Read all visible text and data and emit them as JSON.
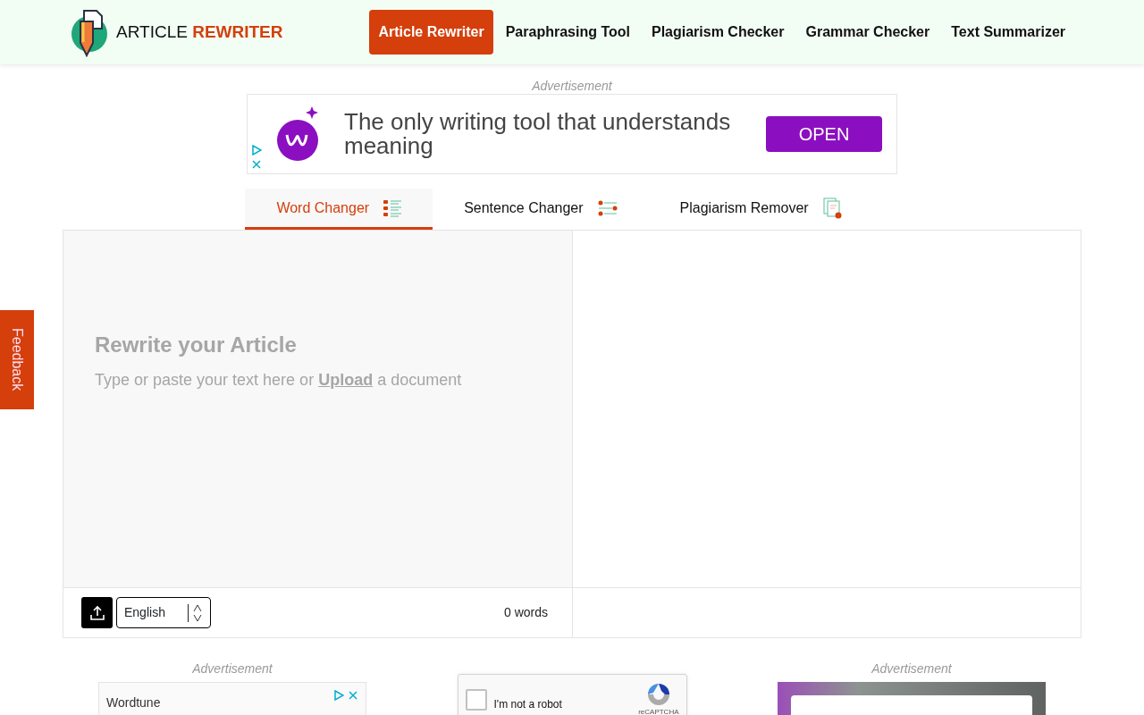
{
  "header": {
    "logo": {
      "word_1": "ARTICLE",
      "word_2": "REWRITER"
    },
    "nav": [
      {
        "label": "Article Rewriter",
        "selected": true
      },
      {
        "label": "Paraphrasing Tool",
        "selected": false
      },
      {
        "label": "Plagiarism Checker",
        "selected": false
      },
      {
        "label": "Grammar Checker",
        "selected": false
      },
      {
        "label": "Text Summarizer",
        "selected": false
      }
    ]
  },
  "top_ad": {
    "label": "Advertisement",
    "headline": "The only writing tool that understands meaning",
    "button": "OPEN"
  },
  "tabs": [
    {
      "label": "Word Changer",
      "selected": true,
      "kind": "list"
    },
    {
      "label": "Sentence Changer",
      "selected": false,
      "kind": "sliders"
    },
    {
      "label": "Plagiarism Remover",
      "selected": false,
      "kind": "copy"
    }
  ],
  "editor": {
    "title": "Rewrite your Article",
    "hint_before": "Type or paste your text here or",
    "link": "Upload",
    "hint_after": "a document",
    "language": "English",
    "word_count": "0 words"
  },
  "feedback": "Feedback",
  "bottom": {
    "left_ad": {
      "label": "Advertisement",
      "title": "Wordtune"
    },
    "captcha": {
      "label": "I'm not a robot",
      "brand": "reCAPTCHA",
      "checked": false
    },
    "right_ad": {
      "label": "Advertisement"
    }
  }
}
